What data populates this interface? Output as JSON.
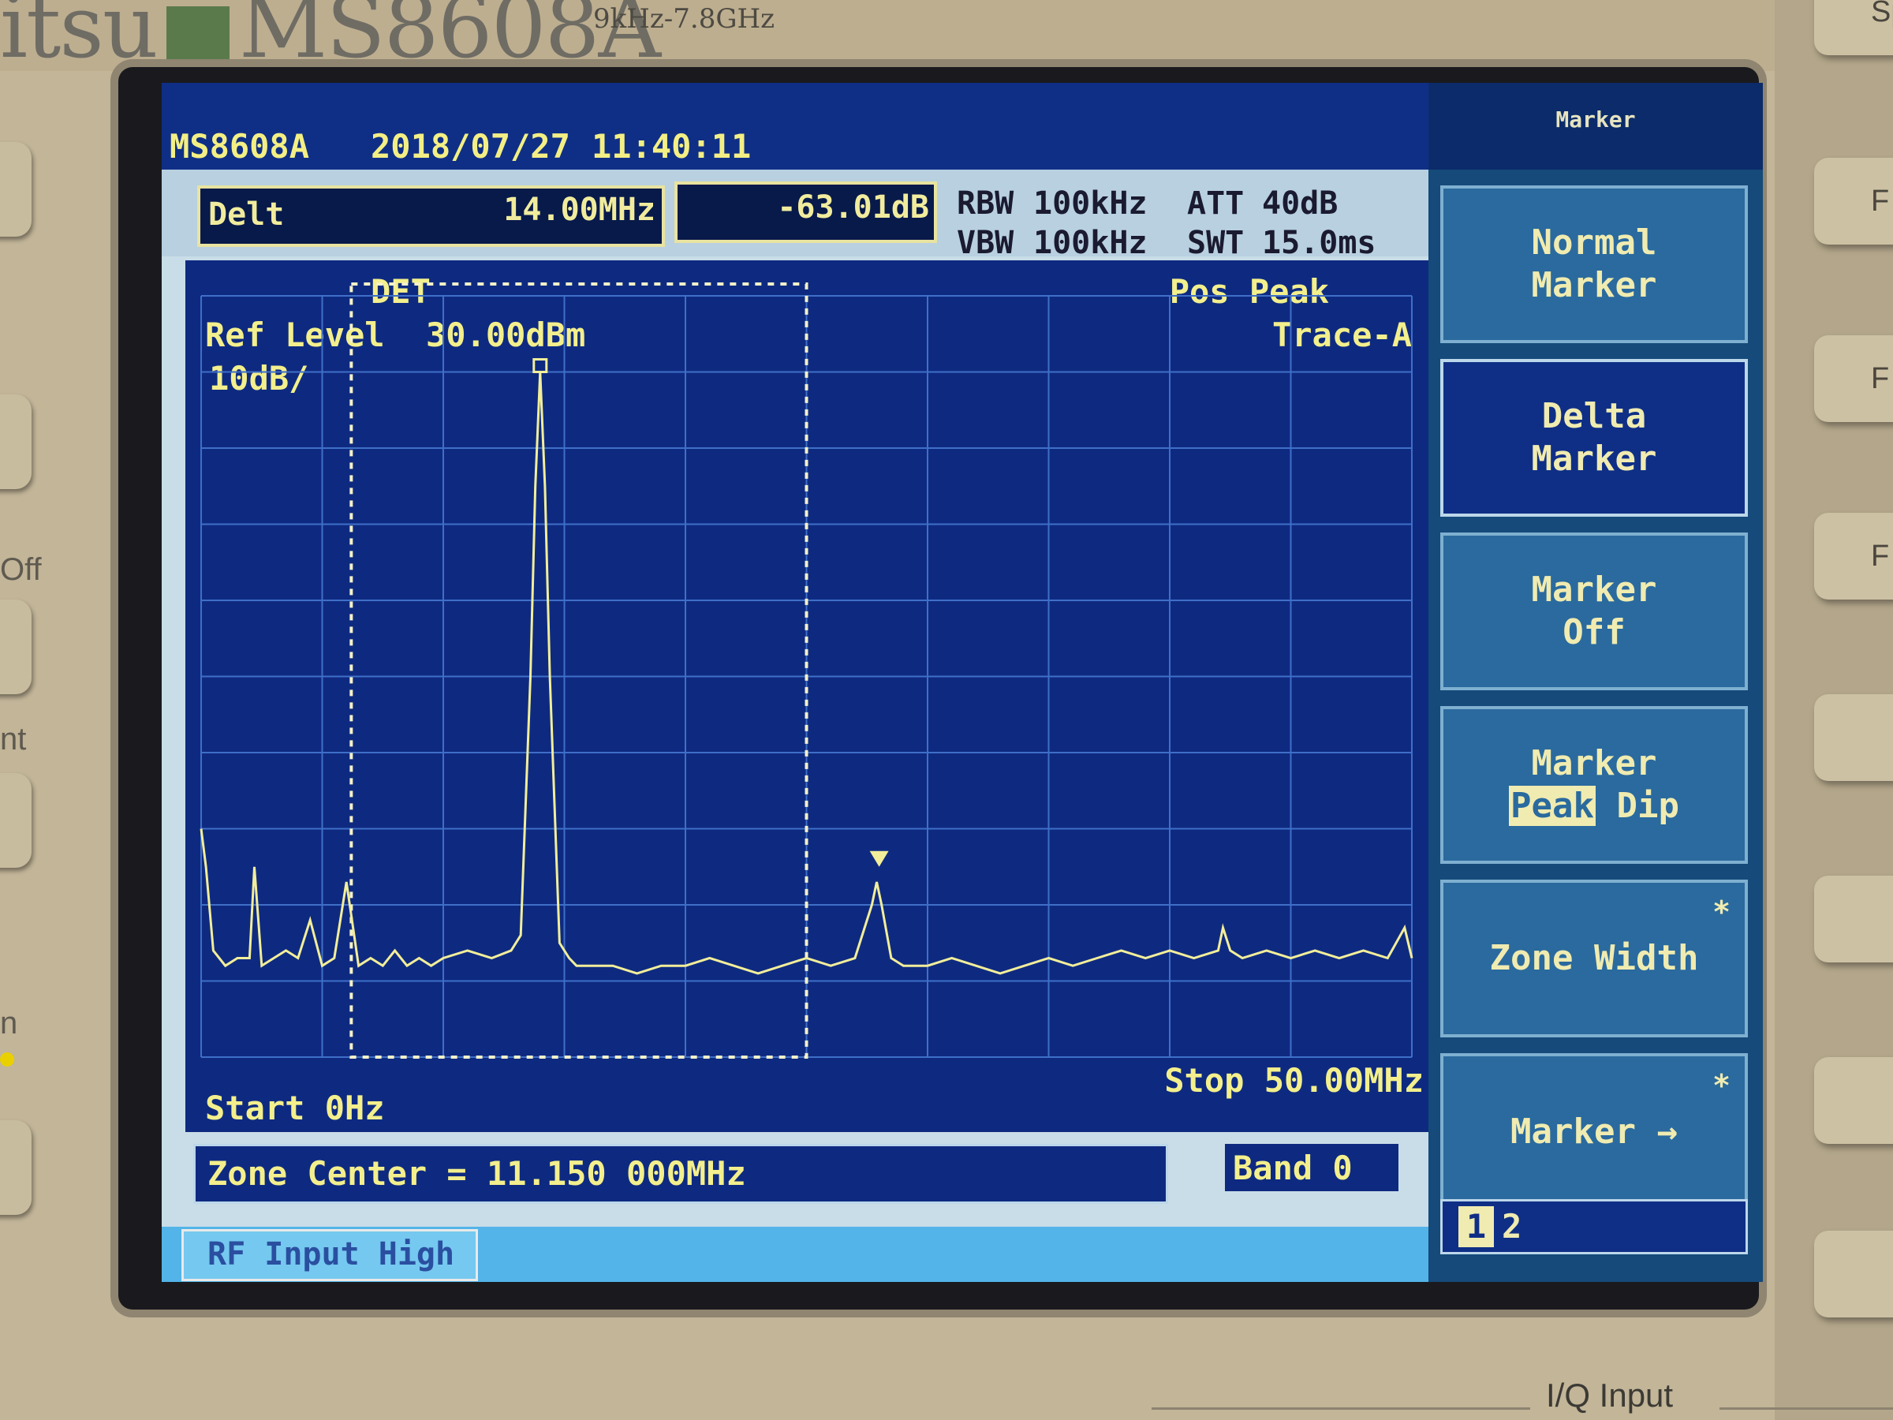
{
  "device": {
    "brand": "itsu",
    "model": "MS8608A",
    "freq_range": "9kHz-7.8GHz",
    "left_labels": [
      "Off",
      "nt",
      "n"
    ],
    "right_keys": [
      "Spe",
      "F",
      "F",
      "F"
    ],
    "bottom_label": "I/Q Input"
  },
  "header": {
    "model": "MS8608A",
    "date": "2018/07/27",
    "time": "11:40:11",
    "menu_title": "Marker"
  },
  "marker": {
    "mode": "Delt",
    "freq": "14.00MHz",
    "level": "-63.01dB"
  },
  "params": {
    "rbw_label": "RBW",
    "rbw": "100kHz",
    "vbw_label": "VBW",
    "vbw": "100kHz",
    "att_label": "ATT",
    "att": "40dB",
    "swt_label": "SWT",
    "swt": "15.0ms",
    "det_label": "DET",
    "det": "Pos Peak",
    "trace": "Trace-A"
  },
  "graph": {
    "ref_level_label": "Ref Level",
    "ref_level": "30.00dBm",
    "scale": "10dB/",
    "start": "Start 0Hz",
    "stop": "Stop 50.00MHz"
  },
  "footer": {
    "zone_center": "Zone Center = 11.150 000MHz",
    "band": "Band 0",
    "rf_input": "RF Input High"
  },
  "softkeys": [
    {
      "line1": "Normal",
      "line2": "Marker",
      "star": ""
    },
    {
      "line1": "Delta",
      "line2": "Marker",
      "star": ""
    },
    {
      "line1": "Marker",
      "line2": "Off",
      "star": ""
    },
    {
      "line1": "Marker",
      "line2_hl": "Peak",
      "line2_rest": " Dip",
      "star": ""
    },
    {
      "line1": "Zone Width",
      "line2": "",
      "star": "*"
    },
    {
      "line1": "Marker →",
      "line2": "",
      "star": "*"
    }
  ],
  "pages": {
    "current": "1",
    "next": "2"
  },
  "colors": {
    "trace": "#f2ee9a",
    "graph_bg": "#0e2a80",
    "grid": "#3f6fc8",
    "softkey": "#2a6a9e",
    "status_bar": "#52b4e8"
  },
  "chart_data": {
    "type": "line",
    "xlabel": "",
    "ylabel": "",
    "xlim": [
      0,
      50
    ],
    "ylim": [
      -70,
      30
    ],
    "x_unit": "MHz",
    "y_unit": "dBm",
    "grid": true,
    "series": [
      {
        "x": [
          0,
          0.2,
          0.5,
          1.0,
          1.5,
          2.0,
          2.2,
          2.5,
          3.0,
          3.5,
          4.0,
          4.5,
          5.0,
          5.5,
          6.0,
          6.5,
          7.0,
          7.5,
          8.0,
          8.5,
          9.0,
          9.5,
          10.0,
          11.0,
          12.0,
          12.8,
          13.2,
          13.6,
          13.8,
          14.0,
          14.2,
          14.4,
          14.8,
          15.2,
          15.5,
          16.0,
          17.0,
          18.0,
          19.0,
          20.0,
          21.0,
          22.0,
          23.0,
          24.0,
          25.0,
          26.0,
          27.0,
          27.7,
          27.9,
          28.1,
          28.5,
          29.0,
          30.0,
          31.0,
          32.0,
          33.0,
          34.0,
          35.0,
          36.0,
          37.0,
          38.0,
          39.0,
          40.0,
          41.0,
          42.0,
          42.2,
          42.5,
          43.0,
          44.0,
          45.0,
          46.0,
          47.0,
          48.0,
          49.0,
          49.7,
          50.0
        ],
        "y": [
          -40,
          -45,
          -56,
          -58,
          -57,
          -57,
          -45,
          -58,
          -57,
          -56,
          -57,
          -52,
          -58,
          -57,
          -47,
          -58,
          -57,
          -58,
          -56,
          -58,
          -57,
          -58,
          -57,
          -56,
          -57,
          -56,
          -54,
          -20,
          5,
          20,
          5,
          -20,
          -55,
          -57,
          -58,
          -58,
          -58,
          -59,
          -58,
          -58,
          -57,
          -58,
          -59,
          -58,
          -57,
          -58,
          -57,
          -50,
          -47,
          -50,
          -57,
          -58,
          -58,
          -57,
          -58,
          -59,
          -58,
          -57,
          -58,
          -57,
          -56,
          -57,
          -56,
          -57,
          -56,
          -53,
          -56,
          -57,
          -56,
          -57,
          -56,
          -57,
          -56,
          -57,
          -53,
          -57
        ]
      }
    ],
    "markers": [
      {
        "label": "reference",
        "x": 14.0,
        "y": 20
      },
      {
        "label": "delta",
        "x": 28.0,
        "y": -45
      }
    ],
    "zone": {
      "x_start": 6.2,
      "x_end": 25.0
    }
  }
}
